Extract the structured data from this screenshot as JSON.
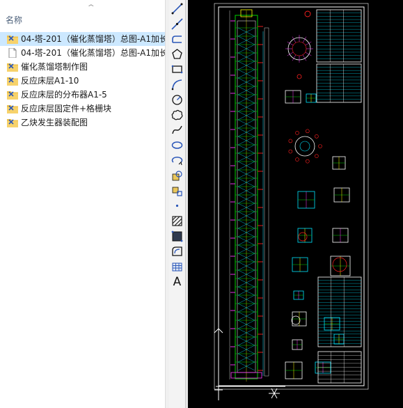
{
  "file_panel": {
    "column_header": "名称",
    "files": [
      {
        "name": "04-塔-201（催化蒸馏塔）总图-A1加长",
        "icon": "cad-drawing-icon",
        "selected": true
      },
      {
        "name": "04-塔-201（催化蒸馏塔）总图-A1加长",
        "icon": "blank-document-icon",
        "selected": false
      },
      {
        "name": "催化蒸馏塔制作图",
        "icon": "cad-drawing-icon",
        "selected": false
      },
      {
        "name": "反应床层A1-10",
        "icon": "cad-drawing-icon",
        "selected": false
      },
      {
        "name": "反应床层的分布器A1-5",
        "icon": "cad-drawing-icon",
        "selected": false
      },
      {
        "name": "反应床层固定件+格栅块",
        "icon": "cad-drawing-icon",
        "selected": false
      },
      {
        "name": "乙炔发生器装配图",
        "icon": "cad-drawing-icon",
        "selected": false
      }
    ]
  },
  "draw_toolbar": {
    "tools": [
      "line-icon",
      "construction-line-icon",
      "polyline-icon",
      "polygon-icon",
      "rectangle-icon",
      "arc-icon",
      "circle-icon",
      "revision-cloud-icon",
      "spline-icon",
      "ellipse-icon",
      "ellipse-arc-icon",
      "insert-block-icon",
      "make-block-icon",
      "point-icon",
      "hatch-icon",
      "gradient-icon",
      "region-icon",
      "table-icon",
      "multiline-text-icon"
    ],
    "text_tool_label": "A"
  },
  "colors": {
    "selection": "#cce8ff",
    "folder": "#f0c34a",
    "cad_background": "#000000",
    "cad_green": "#00d000",
    "cad_cyan": "#00e5ff",
    "cad_magenta": "#ff3cff",
    "cad_yellow": "#ffff00",
    "cad_red": "#ff2020"
  }
}
